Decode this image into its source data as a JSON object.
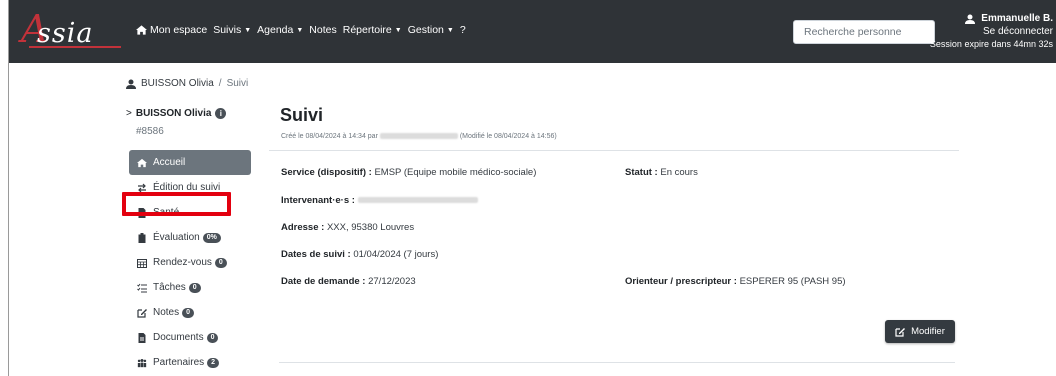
{
  "app": {
    "logo_text": "ssia",
    "logo_initial": "A"
  },
  "nav": {
    "home": "Mon espace",
    "suivis": "Suivis",
    "agenda": "Agenda",
    "notes": "Notes",
    "repertoire": "Répertoire",
    "gestion": "Gestion",
    "help": "?"
  },
  "search": {
    "placeholder": "Recherche personne",
    "value": ""
  },
  "user": {
    "name": "Emmanuelle B.",
    "logout": "Se déconnecter",
    "session": "Session expire dans 44mn 32s"
  },
  "breadcrumb": {
    "person": "BUISSON Olivia",
    "separator": "/",
    "current": "Suivi"
  },
  "sidebar": {
    "person_name": "BUISSON Olivia",
    "person_badge": "i",
    "person_id": "#8586",
    "items": [
      {
        "label": "Accueil",
        "icon": "home-icon",
        "badge": ""
      },
      {
        "label": "Édition du suivi",
        "icon": "exchange-icon",
        "badge": ""
      },
      {
        "label": "Santé",
        "icon": "file-medical-icon",
        "badge": ""
      },
      {
        "label": "Évaluation",
        "icon": "clipboard-icon",
        "badge": "0%"
      },
      {
        "label": "Rendez-vous",
        "icon": "calendar-icon",
        "badge": "0"
      },
      {
        "label": "Tâches",
        "icon": "tasks-icon",
        "badge": "0"
      },
      {
        "label": "Notes",
        "icon": "edit-icon",
        "badge": "0"
      },
      {
        "label": "Documents",
        "icon": "file-icon",
        "badge": "0"
      },
      {
        "label": "Partenaires",
        "icon": "users-icon",
        "badge": "2"
      }
    ]
  },
  "main": {
    "title": "Suivi",
    "meta_created": "Créé le 08/04/2024 à 14:34 par",
    "meta_modified": "(Modifié le 08/04/2024 à 14:56)",
    "service_label": "Service (dispositif) :",
    "service_value": "EMSP (Equipe mobile médico-sociale)",
    "statut_label": "Statut :",
    "statut_value": "En cours",
    "intervenants_label": "Intervenant·e·s :",
    "adresse_label": "Adresse :",
    "adresse_value": "XXX, 95380 Louvres",
    "dates_label": "Dates de suivi :",
    "dates_value": "01/04/2024 (7 jours)",
    "demande_label": "Date de demande :",
    "demande_value": "27/12/2023",
    "orienteur_label": "Orienteur / prescripteur :",
    "orienteur_value": "ESPERER 95 (PASH 95)",
    "modify_button": "Modifier"
  },
  "colors": {
    "navbar": "#2f3337",
    "brand_red": "#c2323a",
    "active_item": "#6c757d",
    "highlight": "#e3000f"
  }
}
